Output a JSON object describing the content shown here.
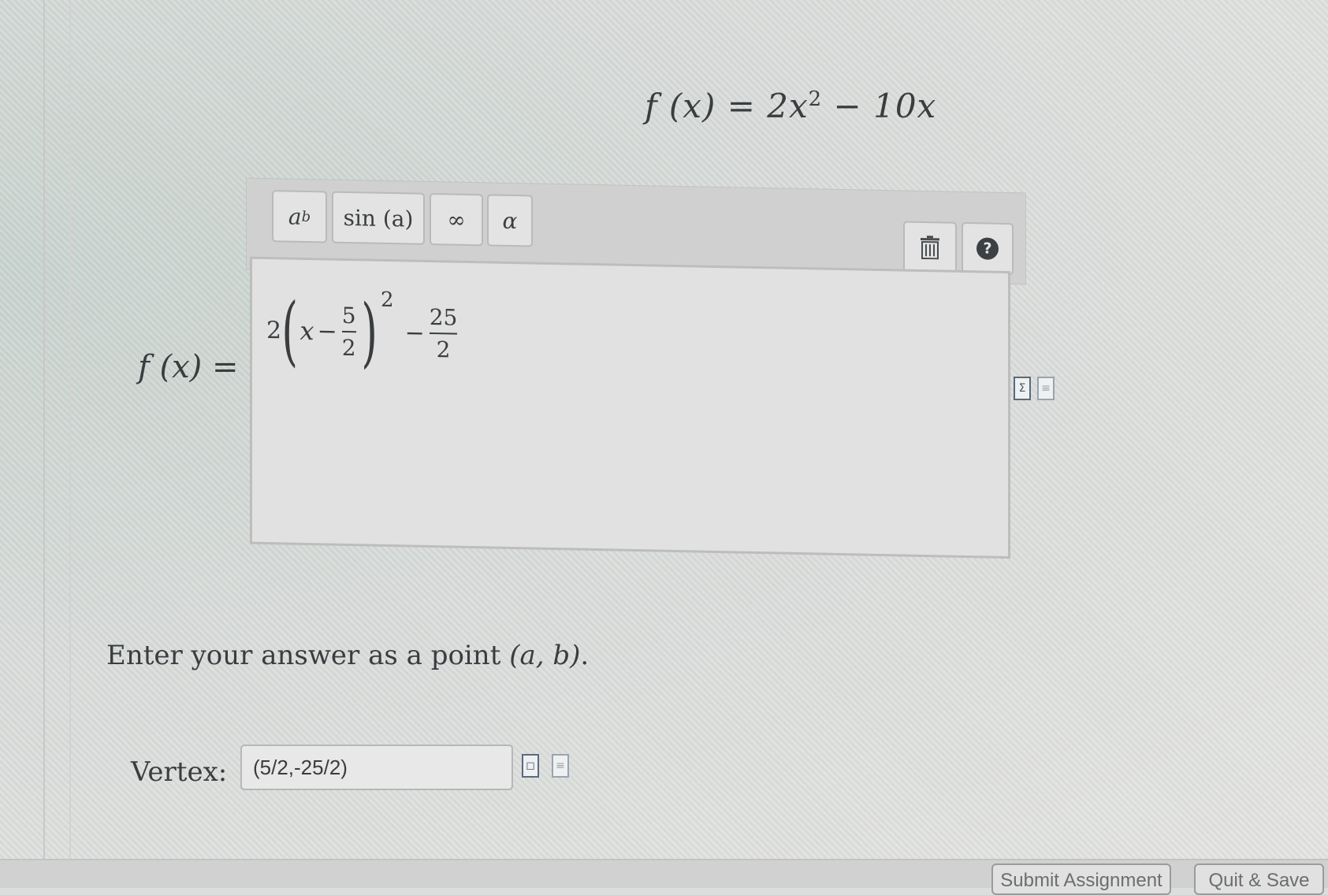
{
  "prompt": {
    "function_lhs": "f (x) = 2x",
    "exponent": "2",
    "function_rhs": " − 10x"
  },
  "answer_label": "f (x) =",
  "toolbar": {
    "power_base": "a",
    "power_exp": "b",
    "sin_label": "sin (a)",
    "infinity_label": "∞",
    "alpha_label": "α",
    "help_label": "?"
  },
  "answer_expression": {
    "coefficient": "2",
    "variable": "x",
    "minus1": "−",
    "frac1_num": "5",
    "frac1_den": "2",
    "exponent": "2",
    "minus2": "−",
    "frac2_num": "25",
    "frac2_den": "2"
  },
  "instruction": {
    "text": "Enter your answer as a point ",
    "point": "(a, b)",
    "end": "."
  },
  "vertex": {
    "label": "Vertex:",
    "value": "(5/2,-25/2)"
  },
  "footer": {
    "submit_label": "Submit Assignment",
    "quit_label": "Quit & Save"
  },
  "icons": [
    "power-icon",
    "sin-icon",
    "infinity-icon",
    "alpha-icon",
    "trash-icon",
    "help-icon",
    "equation-preview-icon",
    "document-icon"
  ]
}
